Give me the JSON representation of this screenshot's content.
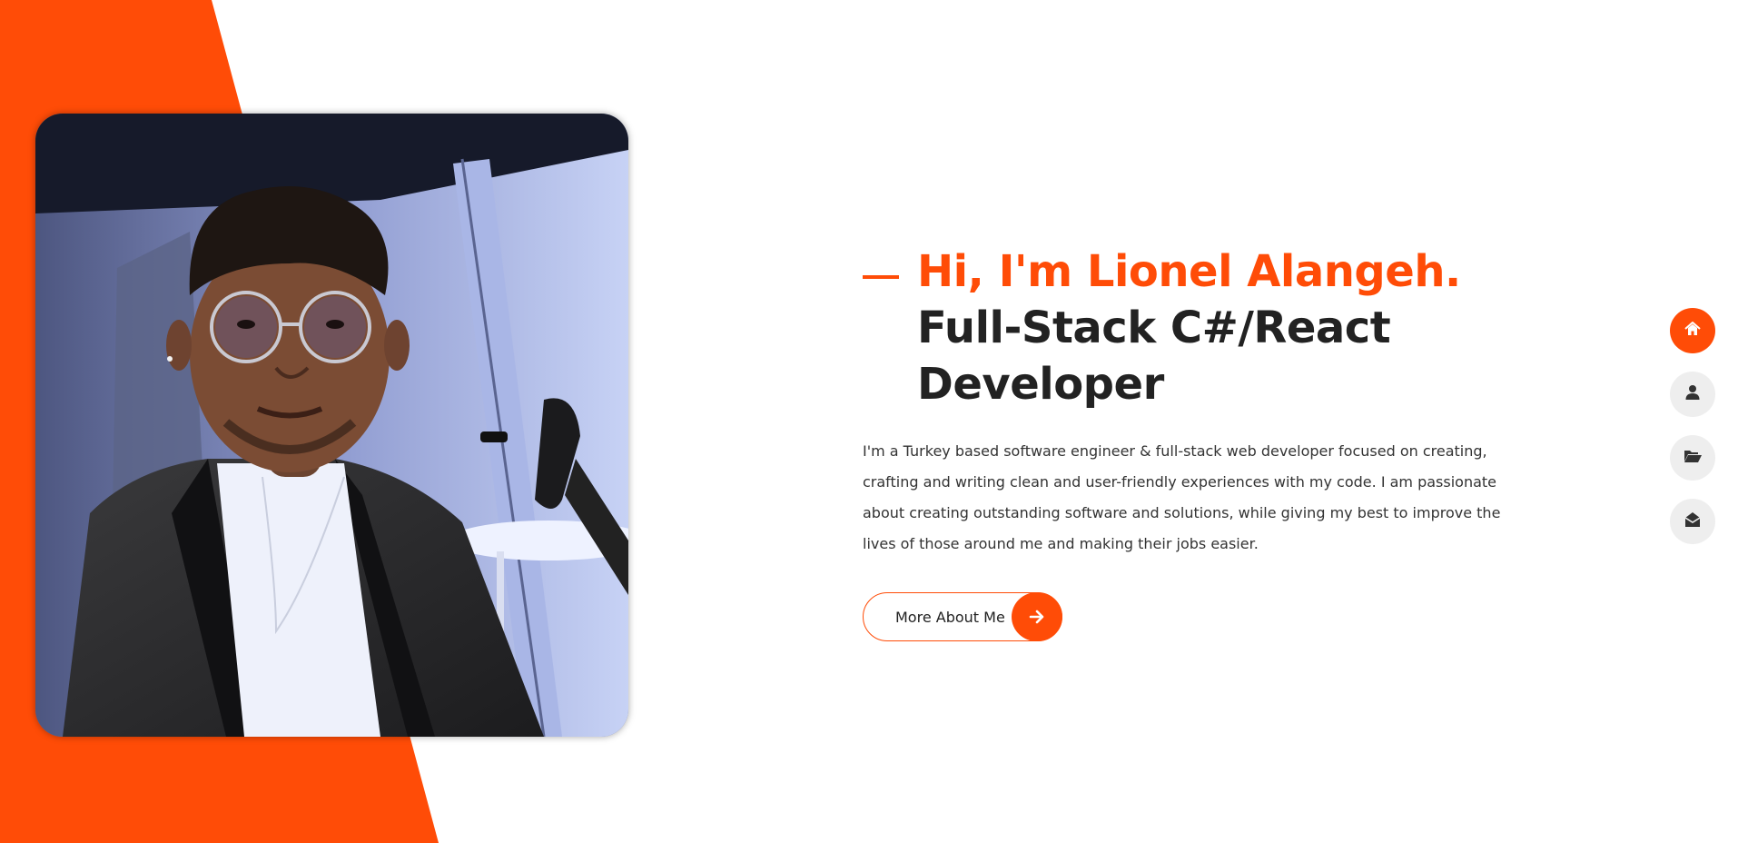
{
  "brand": {
    "accent_color": "#ff4c07",
    "text_dark": "#222222",
    "nav_inactive": "#eeeeee"
  },
  "profile_photo": {
    "description_icon": "portrait-photo"
  },
  "hero": {
    "greeting": "Hi, I'm Lionel Alangeh.",
    "role": "Full-Stack C#/React Developer",
    "bio": "I'm a Turkey based software engineer & full-stack web developer focused on creating, crafting and writing clean and user-friendly experiences with my code. I am passionate about creating outstanding software and solutions, while giving my best to improve the lives of those around me and making their jobs easier.",
    "cta_label": "More About Me",
    "cta_icon": "arrow-right-icon"
  },
  "side_nav": {
    "items": [
      {
        "name": "home",
        "icon": "home-icon",
        "active": true
      },
      {
        "name": "about",
        "icon": "user-icon",
        "active": false
      },
      {
        "name": "portfolio",
        "icon": "folder-open-icon",
        "active": false
      },
      {
        "name": "contact",
        "icon": "envelope-open-icon",
        "active": false
      }
    ]
  }
}
